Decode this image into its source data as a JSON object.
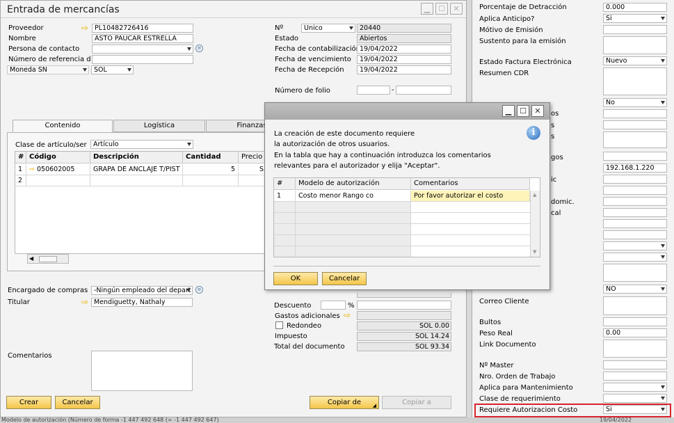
{
  "window": {
    "title": "Entrada de mercancías"
  },
  "header_left": {
    "proveedor_label": "Proveedor",
    "proveedor_value": "PL10482726416",
    "nombre_label": "Nombre",
    "nombre_value": "ASTO PAUCAR ESTRELLA",
    "contacto_label": "Persona de contacto",
    "referencia_label": "Número de referencia d",
    "moneda_label": "Moneda SN",
    "moneda_value": "SOL"
  },
  "header_right": {
    "numero_label": "Nº",
    "serie_value": "Unico",
    "numero_value": "20440",
    "estado_label": "Estado",
    "estado_value": "Abiertos",
    "fcont_label": "Fecha de contabilización",
    "fcont_value": "19/04/2022",
    "fvenc_label": "Fecha de vencimiento",
    "fvenc_value": "19/04/2022",
    "frec_label": "Fecha de Recepción",
    "frec_value": "19/04/2022",
    "folio_label": "Número de folio",
    "folio_sep": "-"
  },
  "tabs": [
    "Contenido",
    "Logística",
    "Finanzas"
  ],
  "contenido": {
    "clase_label": "Clase de artículo/ser",
    "clase_value": "Artículo",
    "columns": [
      "#",
      "Código",
      "Descripción",
      "Cantidad",
      "Precio"
    ],
    "rows": [
      {
        "n": "1",
        "codigo": "050602005",
        "desc": "GRAPA DE ANCLAJE T/PIST",
        "cant": "5",
        "precio": "S"
      },
      {
        "n": "2",
        "codigo": "",
        "desc": "",
        "cant": "",
        "precio": ""
      }
    ]
  },
  "footer_left": {
    "encargado_label": "Encargado de compras",
    "encargado_value": "-Ningún empleado del depart",
    "titular_label": "Titular",
    "titular_value": "Mendiguetty, Nathaly",
    "comentarios_label": "Comentarios"
  },
  "totals": {
    "descuento_label": "Descuento",
    "pct": "%",
    "gastos_label": "Gastos adicionales",
    "redondeo_label": "Redondeo",
    "redondeo_value": "SOL 0.00",
    "impuesto_label": "Impuesto",
    "impuesto_value": "SOL 14.24",
    "total_label": "Total del documento",
    "total_value": "SOL 93.34"
  },
  "buttons": {
    "crear": "Crear",
    "cancelar": "Cancelar",
    "copiar_de": "Copiar de",
    "copiar_a": "Copiar a"
  },
  "right_panel": {
    "rows": [
      {
        "label": "Porcentaje de Detracción",
        "value": "0.000",
        "kind": "text"
      },
      {
        "label": "Aplica Anticipo?",
        "value": "Si",
        "kind": "select"
      },
      {
        "label": "Mótivo de Emisión",
        "value": "",
        "kind": "text"
      },
      {
        "label": "Sustento para la emisión",
        "value": "",
        "kind": "area"
      },
      {
        "label": "Estado Factura Electrónica",
        "value": "Nuevo",
        "kind": "select"
      },
      {
        "label": "Resumen CDR",
        "value": "",
        "kind": "area"
      }
    ],
    "partial_labels": [
      "os",
      "s",
      "s",
      "gos",
      "ic",
      "domic.",
      "cal"
    ],
    "no_value": "No",
    "ip_value": "192.168.1.220",
    "no2_value": "NO",
    "correo_label": "Correo Cliente",
    "bultos_label": "Bultos",
    "peso_label": "Peso Real",
    "peso_value": "0.00",
    "link_label": "Link Documento",
    "master_label": "Nº Master",
    "orden_label": "Nro. Orden de Trabajo",
    "mant_label": "Aplica para Mantenimiento",
    "clase_req_label": "Clase de requerimiento",
    "req_auth_label": "Requiere Autorizacion Costo",
    "req_auth_value": "Si",
    "highlight_color": "#d9232d"
  },
  "status_bar": {
    "left": "Modelo de autorización (Número de forma -1 447 492 648 (= -1 447 492 647)",
    "right": "19/04/2022"
  },
  "dialog": {
    "message_lines": [
      "La creación de este documento requiere",
      "la autorización de otros usuarios.",
      "En la tabla que hay a continuación introduzca los comentarios",
      "relevantes para el autorizador y elija \"Aceptar\"."
    ],
    "columns": [
      "#",
      "Modelo de autorización",
      "Comentarios"
    ],
    "rows": [
      {
        "n": "1",
        "modelo": "Costo menor Rango co",
        "comentario": "Por favor autorizar el costo"
      }
    ],
    "ok": "OK",
    "cancel": "Cancelar"
  }
}
